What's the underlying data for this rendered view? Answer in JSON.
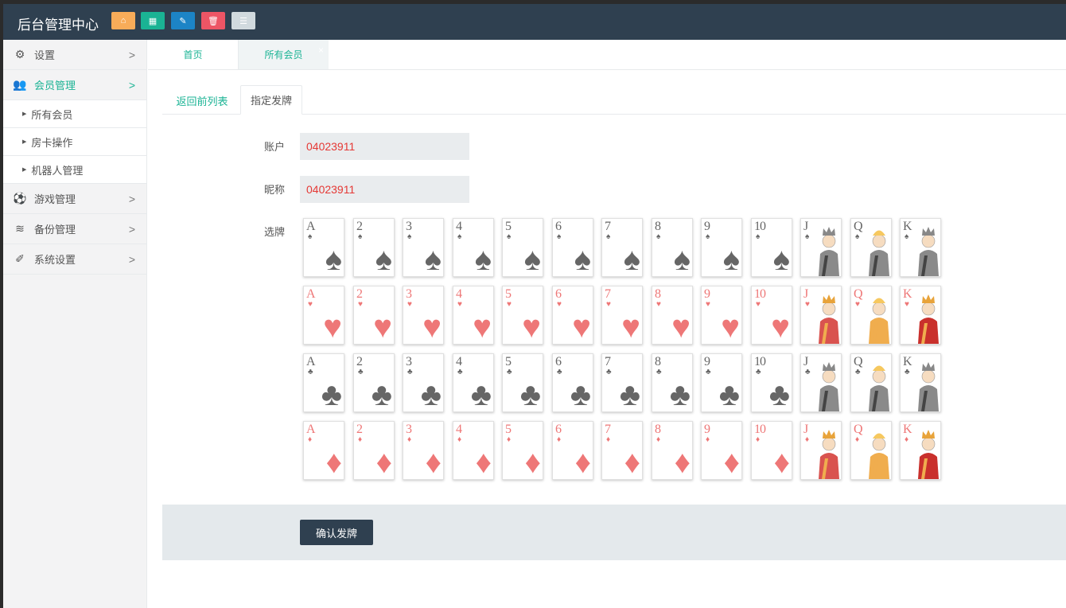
{
  "app": {
    "title": "后台管理中心"
  },
  "toolbar": [
    {
      "icon": "home-icon",
      "glyph": "⌂",
      "color": "#f8ac59"
    },
    {
      "icon": "grid-icon",
      "glyph": "▦",
      "color": "#1ab394"
    },
    {
      "icon": "pencil-icon",
      "glyph": "✎",
      "color": "#1c84c6"
    },
    {
      "icon": "trash-icon",
      "glyph": "🗑",
      "color": "#ed5565"
    },
    {
      "icon": "list-icon",
      "glyph": "☰",
      "color": "#d1dade"
    }
  ],
  "sidebar": {
    "items": [
      {
        "label": "设置",
        "icon": "gears-icon",
        "glyph": "⚙",
        "arrow": ">"
      },
      {
        "label": "会员管理",
        "icon": "users-icon",
        "glyph": "👥",
        "arrow": ">",
        "active": true
      },
      {
        "label": "游戏管理",
        "icon": "soccer-ball-icon",
        "glyph": "⚽",
        "arrow": ">"
      },
      {
        "label": "备份管理",
        "icon": "database-icon",
        "glyph": "≋",
        "arrow": ">"
      },
      {
        "label": "系统设置",
        "icon": "plug-icon",
        "glyph": "✐",
        "arrow": ">"
      }
    ],
    "sub_items": [
      "所有会员",
      "房卡操作",
      "机器人管理"
    ]
  },
  "page_tabs": [
    {
      "label": "首页"
    },
    {
      "label": "所有会员",
      "close": "×"
    }
  ],
  "content_tabs": [
    {
      "label": "返回前列表"
    },
    {
      "label": "指定发牌"
    }
  ],
  "form": {
    "account_label": "账户",
    "account_value": "04023911",
    "nickname_label": "昵称",
    "nickname_value": "04023911",
    "select_label": "选牌"
  },
  "cards": {
    "ranks": [
      "A",
      "2",
      "3",
      "4",
      "5",
      "6",
      "7",
      "8",
      "9",
      "10",
      "J",
      "Q",
      "K"
    ],
    "suits": [
      {
        "name": "spades",
        "symbol": "♠",
        "color": "black"
      },
      {
        "name": "hearts",
        "symbol": "♥",
        "color": "red"
      },
      {
        "name": "clubs",
        "symbol": "♣",
        "color": "black"
      },
      {
        "name": "diamonds",
        "symbol": "♦",
        "color": "red"
      }
    ]
  },
  "confirm_label": "确认发牌",
  "colors": {
    "topbar": "#2f4050",
    "accent": "#1ab394",
    "value_red": "#e53935",
    "card_red": "#ee7777",
    "card_black": "#666666"
  }
}
